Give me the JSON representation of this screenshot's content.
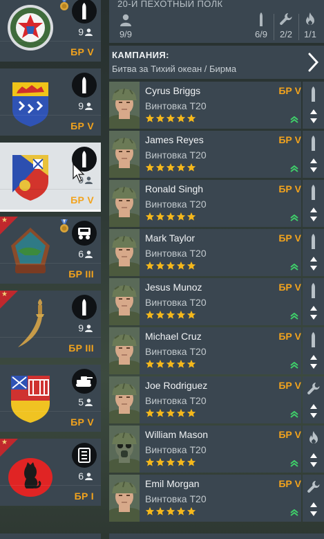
{
  "header": {
    "title": "20-Й ПЕХОТНЫЙ ПОЛК",
    "stats": [
      {
        "icon": "person-icon",
        "value": "9/9"
      },
      {
        "icon": "bullet-icon",
        "value": "6/9"
      },
      {
        "icon": "wrench-icon",
        "value": "2/2"
      },
      {
        "icon": "flame-icon",
        "value": "1/1"
      }
    ]
  },
  "campaign": {
    "label": "КАМПАНИЯ:",
    "value": "Битва за Тихий океан / Бирма"
  },
  "squads": [
    {
      "count": "9",
      "br": "БР V",
      "type_icon": "bullet-icon",
      "emblem": "red-white-blue-insignia",
      "medal": true,
      "ribbon": false,
      "selected": false
    },
    {
      "count": "9",
      "br": "БР V",
      "type_icon": "bullet-icon",
      "emblem": "blue-yellow-crest",
      "medal": false,
      "ribbon": false,
      "selected": false
    },
    {
      "count": "9",
      "br": "БР V",
      "type_icon": "bullet-icon",
      "emblem": "red-yellow-shield",
      "medal": false,
      "ribbon": false,
      "selected": true
    },
    {
      "count": "6",
      "br": "БР III",
      "type_icon": "vehicle-icon",
      "emblem": "crocodile-badge",
      "medal": true,
      "ribbon": true,
      "selected": false
    },
    {
      "count": "9",
      "br": "БР III",
      "type_icon": "bullet-icon",
      "emblem": "dagger",
      "medal": false,
      "ribbon": true,
      "selected": false
    },
    {
      "count": "5",
      "br": "БР V",
      "type_icon": "tank-icon",
      "emblem": "castle-shield",
      "medal": false,
      "ribbon": false,
      "selected": false
    },
    {
      "count": "6",
      "br": "БР I",
      "type_icon": "document-icon",
      "emblem": "red-cat-circle",
      "medal": false,
      "ribbon": true,
      "selected": false
    }
  ],
  "soldiers": [
    {
      "name": "Cyrus Briggs",
      "weapon": "Винтовка Т20",
      "br": "БР V",
      "stars": 5,
      "side_icon": "bullet-icon",
      "gasmask": false
    },
    {
      "name": "James Reyes",
      "weapon": "Винтовка Т20",
      "br": "БР V",
      "stars": 5,
      "side_icon": "bullet-icon",
      "gasmask": false
    },
    {
      "name": "Ronald Singh",
      "weapon": "Винтовка Т20",
      "br": "БР V",
      "stars": 5,
      "side_icon": "bullet-icon",
      "gasmask": false
    },
    {
      "name": "Mark Taylor",
      "weapon": "Винтовка Т20",
      "br": "БР V",
      "stars": 5,
      "side_icon": "bullet-icon",
      "gasmask": false
    },
    {
      "name": "Jesus Munoz",
      "weapon": "Винтовка Т20",
      "br": "БР V",
      "stars": 5,
      "side_icon": "bullet-icon",
      "gasmask": false
    },
    {
      "name": "Michael Cruz",
      "weapon": "Винтовка Т20",
      "br": "БР V",
      "stars": 5,
      "side_icon": "bullet-icon",
      "gasmask": false
    },
    {
      "name": "Joe Rodriguez",
      "weapon": "Винтовка Т20",
      "br": "БР V",
      "stars": 5,
      "side_icon": "wrench-icon",
      "gasmask": false
    },
    {
      "name": "William Mason",
      "weapon": "Винтовка Т20",
      "br": "БР V",
      "stars": 5,
      "side_icon": "flame-icon",
      "gasmask": true
    },
    {
      "name": "Emil Morgan",
      "weapon": "Винтовка Т20",
      "br": "БР V",
      "stars": 5,
      "side_icon": "wrench-icon",
      "gasmask": false
    }
  ],
  "colors": {
    "panel": "#3a4650",
    "accent_br": "#f2a31d",
    "star": "#f5b81c",
    "chevron": "#3fd06a",
    "ribbon": "#c0282d"
  }
}
